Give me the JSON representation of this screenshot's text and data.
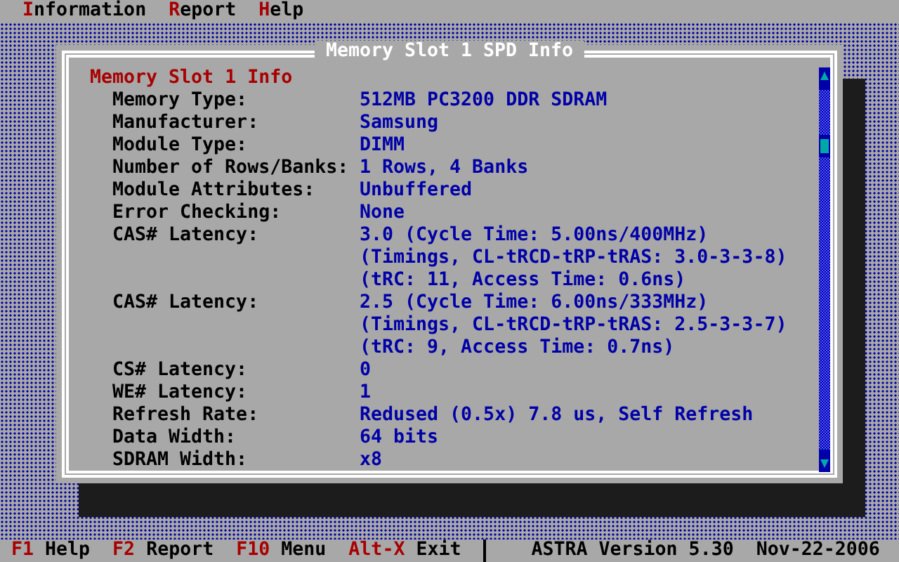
{
  "menu": [
    {
      "hotkey": "I",
      "rest": "nformation"
    },
    {
      "hotkey": "R",
      "rest": "eport"
    },
    {
      "hotkey": "H",
      "rest": "elp"
    }
  ],
  "window": {
    "title": "Memory Slot 1 SPD Info"
  },
  "section": {
    "heading": "Memory Slot 1 Info",
    "fields": [
      {
        "label": "Memory Type:",
        "values": [
          "512MB PC3200 DDR SDRAM"
        ]
      },
      {
        "label": "Manufacturer:",
        "values": [
          "Samsung"
        ]
      },
      {
        "label": "Module Type:",
        "values": [
          "DIMM"
        ]
      },
      {
        "label": "Number of Rows/Banks:",
        "values": [
          "1 Rows, 4 Banks"
        ]
      },
      {
        "label": "Module Attributes:",
        "values": [
          "Unbuffered"
        ]
      },
      {
        "label": "Error Checking:",
        "values": [
          "None"
        ]
      },
      {
        "label": "CAS# Latency:",
        "values": [
          "3.0 (Cycle Time: 5.00ns/400MHz)",
          "(Timings, CL-tRCD-tRP-tRAS: 3.0-3-3-8)",
          "(tRC: 11, Access Time: 0.6ns)"
        ]
      },
      {
        "label": "CAS# Latency:",
        "values": [
          "2.5 (Cycle Time: 6.00ns/333MHz)",
          "(Timings, CL-tRCD-tRP-tRAS: 2.5-3-3-7)",
          "(tRC: 9, Access Time: 0.7ns)"
        ]
      },
      {
        "label": "CS# Latency:",
        "values": [
          "0"
        ]
      },
      {
        "label": "WE# Latency:",
        "values": [
          "1"
        ]
      },
      {
        "label": "Refresh Rate:",
        "values": [
          "Redused (0.5x) 7.8 us, Self Refresh"
        ]
      },
      {
        "label": "Data Width:",
        "values": [
          "64 bits"
        ]
      },
      {
        "label": "SDRAM Width:",
        "values": [
          "x8"
        ]
      }
    ]
  },
  "status_bar": {
    "keys": [
      {
        "key": "F1",
        "action": "Help"
      },
      {
        "key": "F2",
        "action": "Report"
      },
      {
        "key": "F10",
        "action": "Menu"
      },
      {
        "key": "Alt-X",
        "action": "Exit"
      }
    ],
    "version": "ASTRA Version 5.30",
    "date": "Nov-22-2006"
  }
}
